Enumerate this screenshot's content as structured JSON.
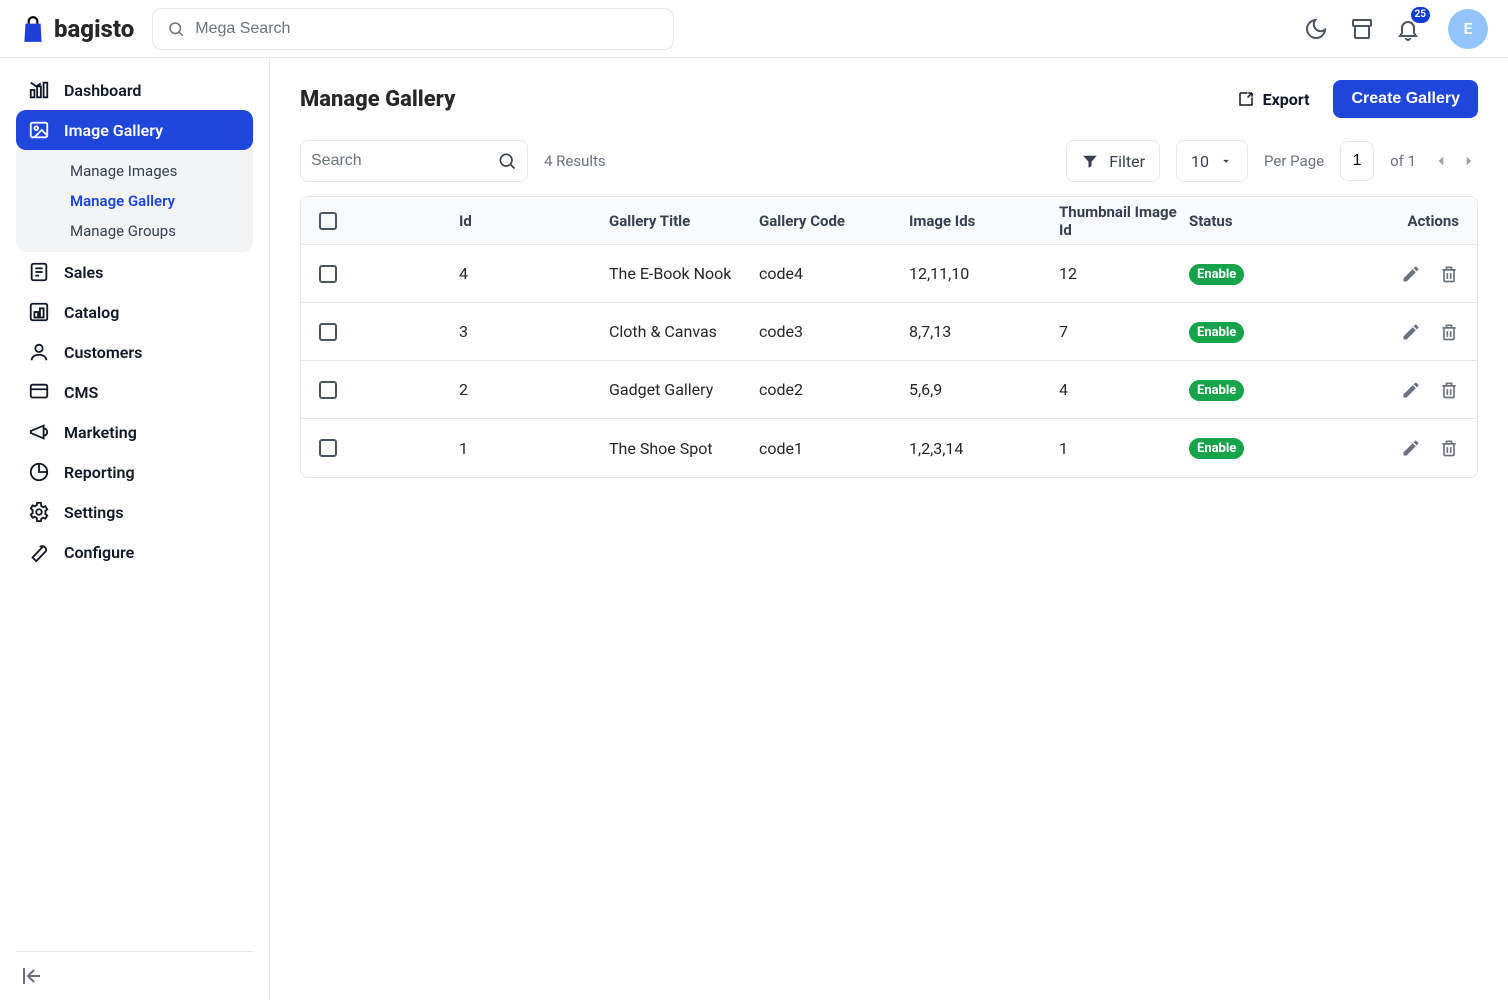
{
  "brand": "bagisto",
  "search_placeholder": "Mega Search",
  "notifications_count": "25",
  "avatar_letter": "E",
  "sidebar": {
    "items": [
      {
        "label": "Dashboard"
      },
      {
        "label": "Image Gallery",
        "sub": [
          {
            "label": "Manage Images"
          },
          {
            "label": "Manage Gallery"
          },
          {
            "label": "Manage Groups"
          }
        ]
      },
      {
        "label": "Sales"
      },
      {
        "label": "Catalog"
      },
      {
        "label": "Customers"
      },
      {
        "label": "CMS"
      },
      {
        "label": "Marketing"
      },
      {
        "label": "Reporting"
      },
      {
        "label": "Settings"
      },
      {
        "label": "Configure"
      }
    ]
  },
  "page": {
    "title": "Manage Gallery",
    "export_label": "Export",
    "create_label": "Create Gallery"
  },
  "toolbar": {
    "search_placeholder": "Search",
    "results_text": "4 Results",
    "filter_label": "Filter",
    "per_page_value": "10",
    "per_page_label": "Per Page",
    "page_value": "1",
    "of_text": "of 1"
  },
  "table": {
    "headers": {
      "id": "Id",
      "title": "Gallery Title",
      "code": "Gallery Code",
      "imageids": "Image Ids",
      "thumb": "Thumbnail Image Id",
      "status": "Status",
      "actions": "Actions"
    },
    "status_enable": "Enable",
    "rows": [
      {
        "id": "4",
        "title": "The E-Book Nook",
        "code": "code4",
        "imageids": "12,11,10",
        "thumb": "12"
      },
      {
        "id": "3",
        "title": "Cloth & Canvas",
        "code": "code3",
        "imageids": "8,7,13",
        "thumb": "7"
      },
      {
        "id": "2",
        "title": "Gadget Gallery",
        "code": "code2",
        "imageids": "5,6,9",
        "thumb": "4"
      },
      {
        "id": "1",
        "title": "The Shoe Spot",
        "code": "code1",
        "imageids": "1,2,3,14",
        "thumb": "1"
      }
    ]
  }
}
